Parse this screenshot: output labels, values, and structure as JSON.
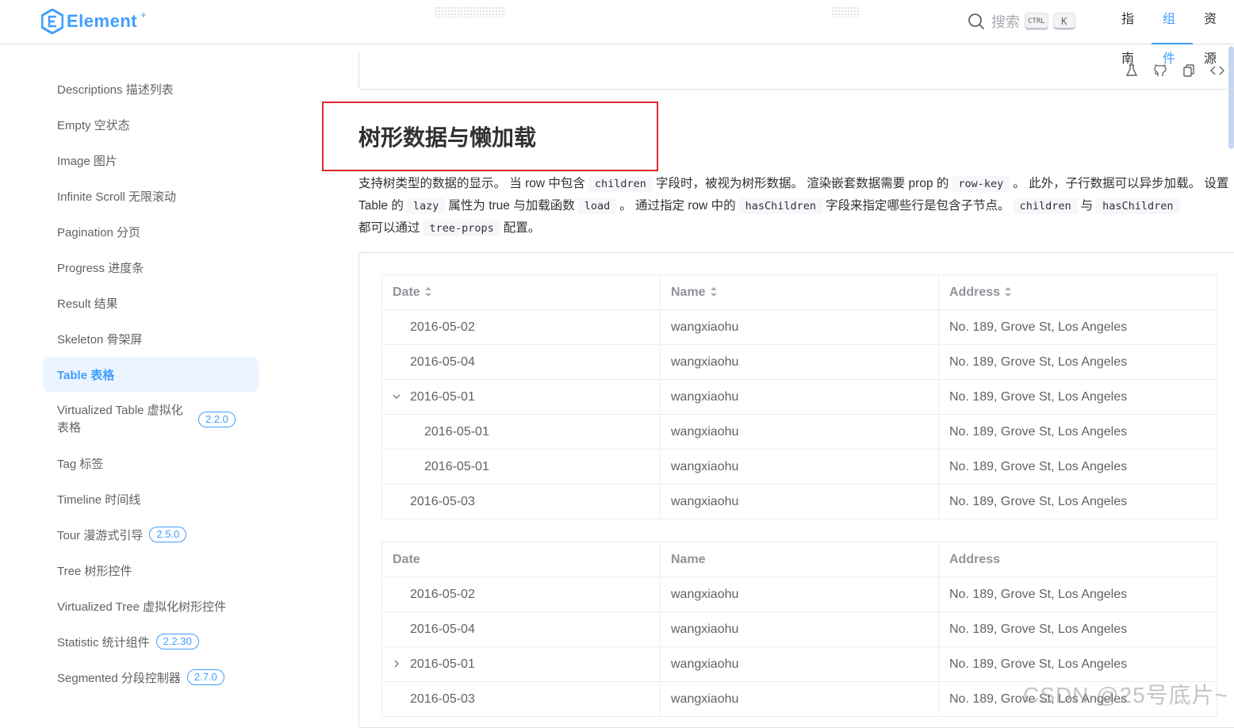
{
  "header": {
    "logo_text": "Element",
    "logo_plus": "+",
    "search_placeholder": "搜索",
    "kbd_ctrl": "CTRL",
    "kbd_k": "K",
    "nav": [
      {
        "label": "指南",
        "active": false
      },
      {
        "label": "组件",
        "active": true
      },
      {
        "label": "资源",
        "active": false
      }
    ]
  },
  "sidebar": {
    "items": [
      {
        "label": "Descriptions 描述列表",
        "active": false,
        "badge": ""
      },
      {
        "label": "Empty 空状态",
        "active": false,
        "badge": ""
      },
      {
        "label": "Image 图片",
        "active": false,
        "badge": ""
      },
      {
        "label": "Infinite Scroll 无限滚动",
        "active": false,
        "badge": ""
      },
      {
        "label": "Pagination 分页",
        "active": false,
        "badge": ""
      },
      {
        "label": "Progress 进度条",
        "active": false,
        "badge": ""
      },
      {
        "label": "Result 结果",
        "active": false,
        "badge": ""
      },
      {
        "label": "Skeleton 骨架屏",
        "active": false,
        "badge": ""
      },
      {
        "label": "Table 表格",
        "active": true,
        "badge": ""
      },
      {
        "label": "Virtualized Table 虚拟化表格",
        "active": false,
        "badge": "2.2.0"
      },
      {
        "label": "Tag 标签",
        "active": false,
        "badge": ""
      },
      {
        "label": "Timeline 时间线",
        "active": false,
        "badge": ""
      },
      {
        "label": "Tour 漫游式引导",
        "active": false,
        "badge": "2.5.0"
      },
      {
        "label": "Tree 树形控件",
        "active": false,
        "badge": ""
      },
      {
        "label": "Virtualized Tree 虚拟化树形控件",
        "active": false,
        "badge": ""
      },
      {
        "label": "Statistic 统计组件",
        "active": false,
        "badge": "2.2.30"
      },
      {
        "label": "Segmented 分段控制器",
        "active": false,
        "badge": "2.7.0"
      }
    ]
  },
  "main": {
    "title": "树形数据与懒加载",
    "desc": {
      "p1": "支持树类型的数据的显示。 当 row 中包含",
      "c1": "children",
      "p2": "字段时，被视为树形数据。 渲染嵌套数据需要 prop 的",
      "c2": "row-key",
      "p3": "。 此外，子行数据可以异步加载。 设置 Table 的",
      "c3": "lazy",
      "p4": "属性为 true 与加载函数",
      "c4": "load",
      "p5": "。 通过指定 row 中的",
      "c5": "hasChildren",
      "p6": "字段来指定哪些行是包含子节点。",
      "c6": "children",
      "p7": "与",
      "c7": "hasChildren",
      "p8": "都可以通过",
      "c8": "tree-props",
      "p9": "配置。"
    },
    "table1": {
      "headers": [
        "Date",
        "Name",
        "Address"
      ],
      "rows": [
        {
          "date": "2016-05-02",
          "name": "wangxiaohu",
          "address": "No. 189, Grove St, Los Angeles",
          "level": 0,
          "expand": ""
        },
        {
          "date": "2016-05-04",
          "name": "wangxiaohu",
          "address": "No. 189, Grove St, Los Angeles",
          "level": 0,
          "expand": ""
        },
        {
          "date": "2016-05-01",
          "name": "wangxiaohu",
          "address": "No. 189, Grove St, Los Angeles",
          "level": 0,
          "expand": "open"
        },
        {
          "date": "2016-05-01",
          "name": "wangxiaohu",
          "address": "No. 189, Grove St, Los Angeles",
          "level": 1,
          "expand": ""
        },
        {
          "date": "2016-05-01",
          "name": "wangxiaohu",
          "address": "No. 189, Grove St, Los Angeles",
          "level": 1,
          "expand": ""
        },
        {
          "date": "2016-05-03",
          "name": "wangxiaohu",
          "address": "No. 189, Grove St, Los Angeles",
          "level": 0,
          "expand": ""
        }
      ]
    },
    "table2": {
      "headers": [
        "Date",
        "Name",
        "Address"
      ],
      "rows": [
        {
          "date": "2016-05-02",
          "name": "wangxiaohu",
          "address": "No. 189, Grove St, Los Angeles",
          "level": 0,
          "expand": ""
        },
        {
          "date": "2016-05-04",
          "name": "wangxiaohu",
          "address": "No. 189, Grove St, Los Angeles",
          "level": 0,
          "expand": ""
        },
        {
          "date": "2016-05-01",
          "name": "wangxiaohu",
          "address": "No. 189, Grove St, Los Angeles",
          "level": 0,
          "expand": "closed"
        },
        {
          "date": "2016-05-03",
          "name": "wangxiaohu",
          "address": "No. 189, Grove St, Los Angeles",
          "level": 0,
          "expand": ""
        }
      ]
    }
  },
  "watermark": "CSDN @25号底片~",
  "colors": {
    "accent": "#409eff",
    "highlight_box": "#e0262a"
  }
}
